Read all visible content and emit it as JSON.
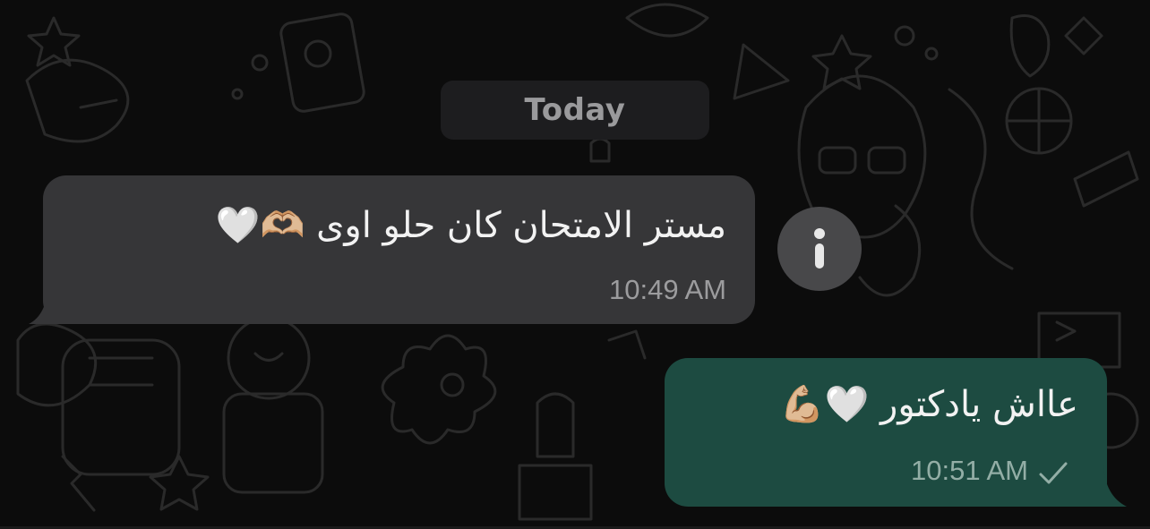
{
  "date_separator": "Today",
  "messages": [
    {
      "direction": "incoming",
      "text": "مستر الامتحان كان حلو اوى 🫶🏼🤍",
      "time": "10:49 AM"
    },
    {
      "direction": "outgoing",
      "text": "عااش يادكتور 🤍💪🏼",
      "time": "10:51 AM",
      "status_icon": "single-check-icon"
    }
  ],
  "info_button": {
    "icon": "info-icon"
  },
  "colors": {
    "background": "#0c0c0c",
    "incoming_bubble": "#363638",
    "outgoing_bubble": "#1d4b41",
    "date_pill": "#1d1d1f"
  }
}
